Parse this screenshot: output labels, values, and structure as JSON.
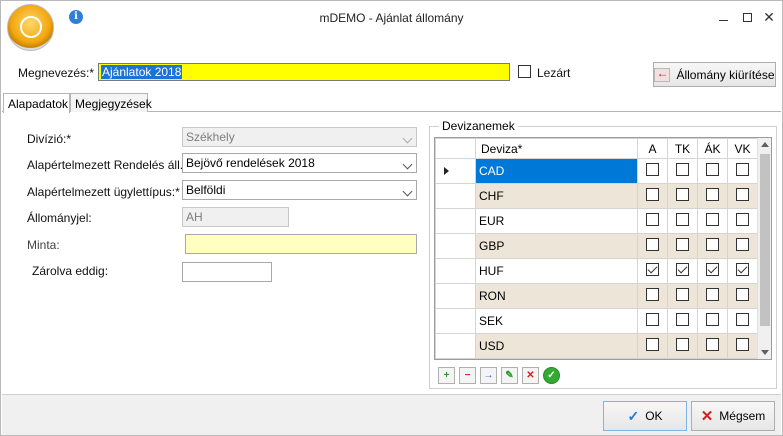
{
  "window": {
    "title": "mDEMO - Ajánlat állomány",
    "controls": {
      "minimize": "–",
      "maximize": "",
      "close": "✕"
    }
  },
  "header": {
    "name_label": "Megnevezés:*",
    "name_value": "Ajánlatok 2018",
    "lezart_label": "Lezárt",
    "lezart_checked": false,
    "clear_button_label": "Állomány kiürítése"
  },
  "tabs": [
    {
      "label": "Alapadatok",
      "active": true
    },
    {
      "label": "Megjegyzések",
      "active": false
    }
  ],
  "form": {
    "divizio": {
      "label": "Divízió:*",
      "value": "Székhely"
    },
    "rendeles": {
      "label": "Alapértelmezett Rendelés áll.:",
      "value": "Bejövő rendelések 2018"
    },
    "ugylettipus": {
      "label": "Alapértelmezett ügylettípus:*",
      "value": "Belföldi"
    },
    "allomanyjel": {
      "label": "Állományjel:",
      "value": "AH"
    },
    "minta": {
      "label": "Minta:",
      "value": ""
    },
    "zarolva": {
      "label": "Zárolva eddig:",
      "value": ""
    }
  },
  "devizanemek": {
    "group_title": "Devizanemek",
    "columns": [
      "Deviza*",
      "A",
      "TK",
      "ÁK",
      "VK"
    ],
    "rows": [
      {
        "code": "CAD",
        "A": false,
        "TK": false,
        "AK": false,
        "VK": false
      },
      {
        "code": "CHF",
        "A": false,
        "TK": false,
        "AK": false,
        "VK": false
      },
      {
        "code": "EUR",
        "A": false,
        "TK": false,
        "AK": false,
        "VK": false
      },
      {
        "code": "GBP",
        "A": false,
        "TK": false,
        "AK": false,
        "VK": false
      },
      {
        "code": "HUF",
        "A": true,
        "TK": true,
        "AK": true,
        "VK": true
      },
      {
        "code": "RON",
        "A": false,
        "TK": false,
        "AK": false,
        "VK": false
      },
      {
        "code": "SEK",
        "A": false,
        "TK": false,
        "AK": false,
        "VK": false
      },
      {
        "code": "USD",
        "A": false,
        "TK": false,
        "AK": false,
        "VK": false
      }
    ],
    "selected_row": 0,
    "nav_icons": [
      "add-row-icon",
      "delete-row-icon",
      "forward-icon",
      "edit-icon",
      "cancel-edit-icon",
      "confirm-icon"
    ]
  },
  "footer": {
    "ok_label": "OK",
    "cancel_label": "Mégsem"
  },
  "colors": {
    "name_bg": "#ffff00",
    "minta_bg": "#ffffc0",
    "row_alt": "#ede6d8",
    "row_selected": "#0078d7"
  }
}
